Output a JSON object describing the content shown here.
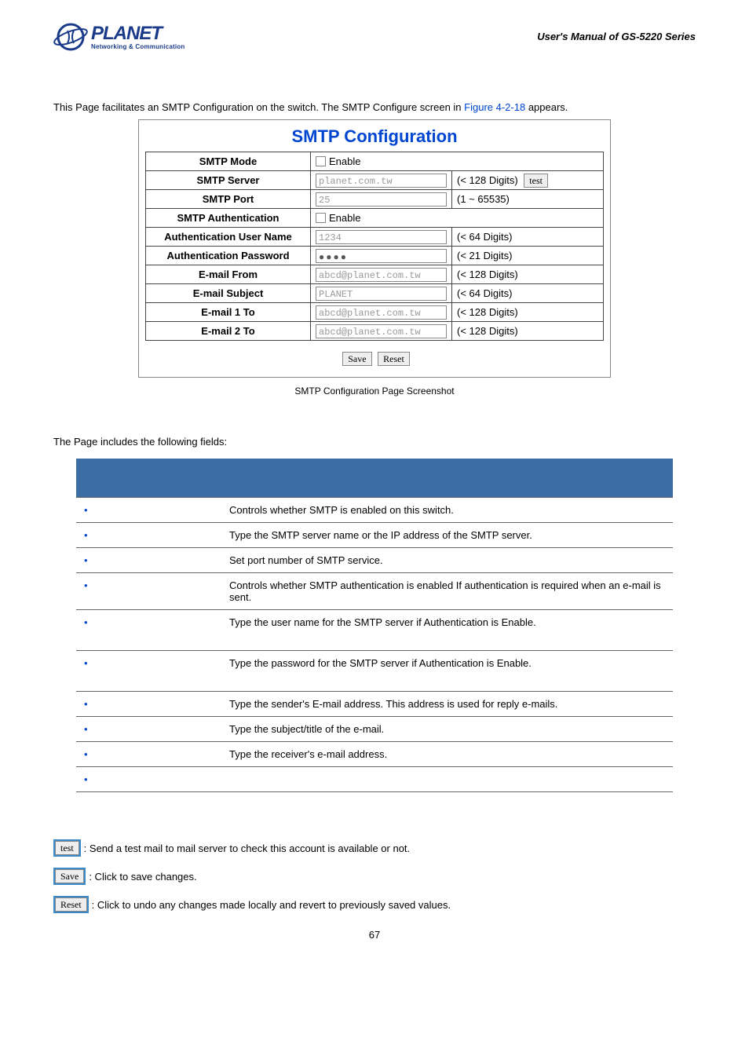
{
  "header": {
    "brand": "PLANET",
    "tagline": "Networking & Communication",
    "manual_title": "User's Manual of GS-5220 Series"
  },
  "intro": {
    "before_link": "This Page facilitates an SMTP Configuration on the switch. The SMTP Configure screen in ",
    "figure_link": "Figure 4-2-18",
    "after_link": " appears."
  },
  "smtp": {
    "heading": "SMTP Configuration",
    "rows": {
      "mode": {
        "label": "SMTP Mode",
        "enable_text": "Enable"
      },
      "server": {
        "label": "SMTP Server",
        "value": "planet.com.tw",
        "hint": "(< 128 Digits)",
        "btn": "test"
      },
      "port": {
        "label": "SMTP Port",
        "value": "25",
        "hint": "(1 ~ 65535)"
      },
      "auth": {
        "label": "SMTP Authentication",
        "enable_text": "Enable"
      },
      "auth_user": {
        "label": "Authentication User Name",
        "value": "1234",
        "hint": "(< 64 Digits)"
      },
      "auth_pass": {
        "label": "Authentication Password",
        "value": "●●●●",
        "hint": "(< 21 Digits)"
      },
      "from": {
        "label": "E-mail From",
        "value": "abcd@planet.com.tw",
        "hint": "(< 128 Digits)"
      },
      "subject": {
        "label": "E-mail Subject",
        "value": "PLANET",
        "hint": "(< 64 Digits)"
      },
      "to1": {
        "label": "E-mail 1 To",
        "value": "abcd@planet.com.tw",
        "hint": "(< 128 Digits)"
      },
      "to2": {
        "label": "E-mail 2 To",
        "value": "abcd@planet.com.tw",
        "hint": "(< 128 Digits)"
      }
    },
    "buttons": {
      "save": "Save",
      "reset": "Reset"
    },
    "caption": "SMTP Configuration Page Screenshot"
  },
  "fields_intro": "The Page includes the following fields:",
  "fields": [
    {
      "desc": "Controls whether SMTP is enabled on this switch."
    },
    {
      "desc": "Type the SMTP server name or the IP address of the SMTP server."
    },
    {
      "desc": "Set port number of SMTP service."
    },
    {
      "desc": "Controls whether SMTP authentication is enabled If authentication is required when an e-mail is sent."
    },
    {
      "desc": "Type the user name for the SMTP server if Authentication is Enable.",
      "tall": true
    },
    {
      "desc": "Type the password for the SMTP server if Authentication is Enable.",
      "tall": true
    },
    {
      "desc": "Type the sender's E-mail address. This address is used for reply e-mails."
    },
    {
      "desc": "Type the subject/title of the e-mail."
    },
    {
      "desc": "Type the receiver's e-mail address."
    },
    {
      "desc": ""
    }
  ],
  "btn_desc": {
    "test": {
      "label": "test",
      "text": ": Send a test mail to mail server to check this account is available or not."
    },
    "save": {
      "label": "Save",
      "text": ": Click to save changes."
    },
    "reset": {
      "label": "Reset",
      "text": ": Click to undo any changes made locally and revert to previously saved values."
    }
  },
  "page_number": "67"
}
